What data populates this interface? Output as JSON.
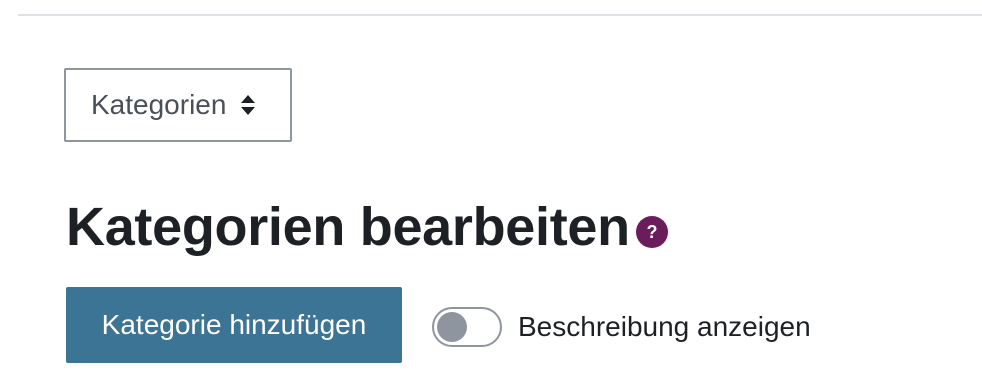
{
  "category_select": {
    "selected_value": "Kategorien",
    "icon": "sort-icon"
  },
  "heading": {
    "title": "Kategorien bearbeiten",
    "help_icon": "question-circle-icon",
    "help_glyph": "?"
  },
  "actions": {
    "add_category_label": "Kategorie hinzufügen"
  },
  "description_toggle": {
    "label": "Beschreibung anzeigen",
    "checked": false
  },
  "colors": {
    "primary_button": "#3c7496",
    "help_icon": "#6a1c5d",
    "text": "#1d2125",
    "border": "#8f959e"
  }
}
